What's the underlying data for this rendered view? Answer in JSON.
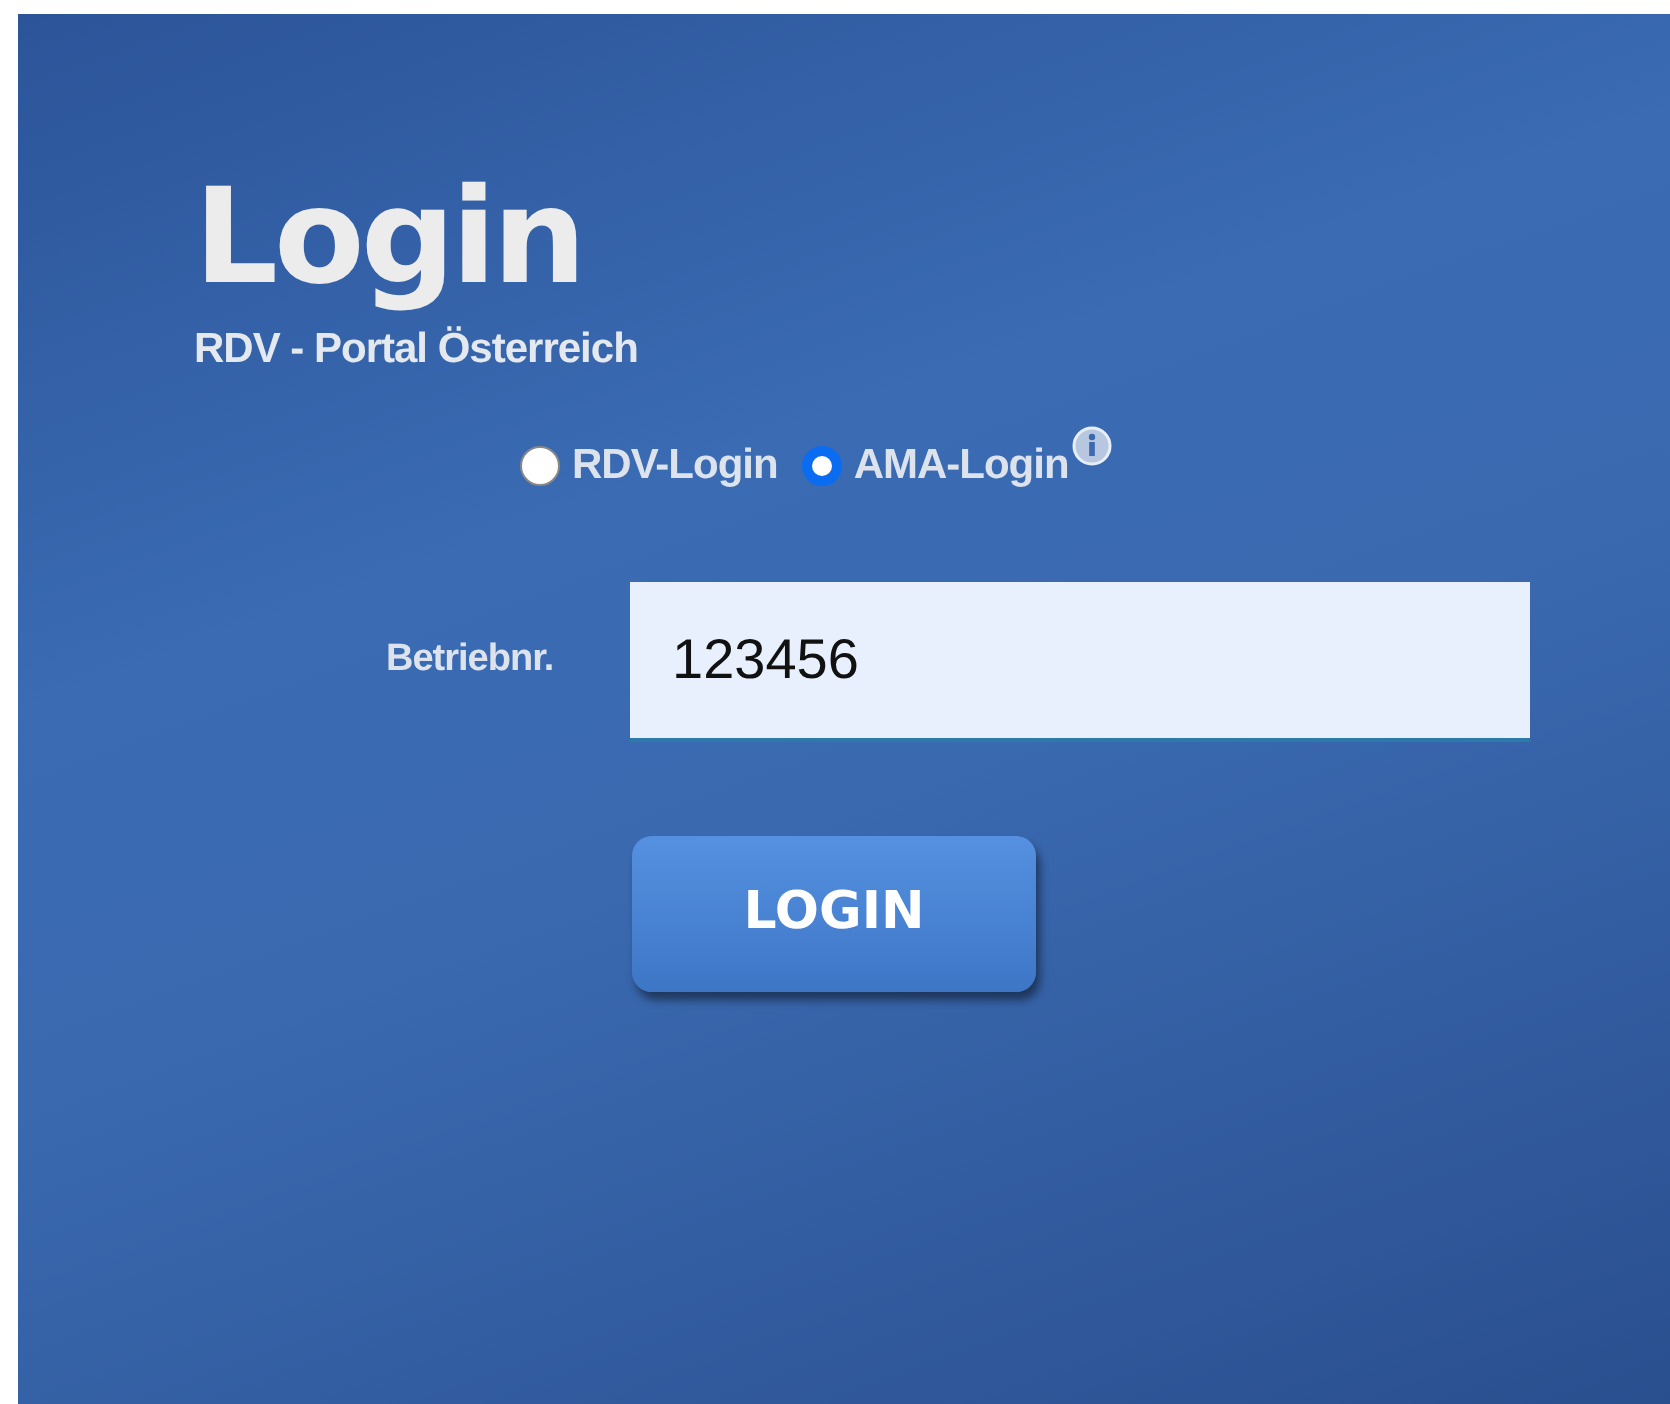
{
  "title": "Login",
  "subtitle": "RDV - Portal Österreich",
  "login_types": [
    {
      "label": "RDV-Login",
      "selected": false,
      "info": false
    },
    {
      "label": "AMA-Login",
      "selected": true,
      "info": true
    }
  ],
  "field": {
    "label": "Betriebnr.",
    "value": "123456"
  },
  "button": "LOGIN"
}
